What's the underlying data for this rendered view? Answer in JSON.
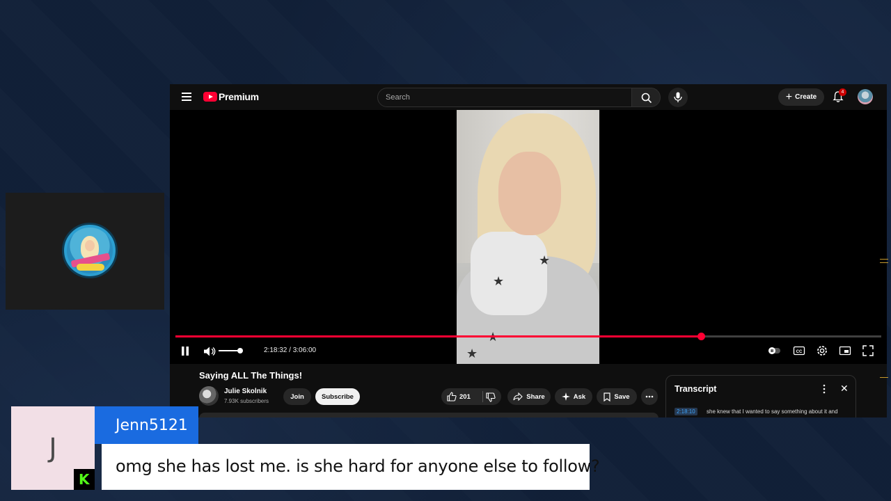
{
  "youtube": {
    "logo_text": "Premium",
    "search_placeholder": "Search",
    "create_label": "Create",
    "notification_count": "4",
    "player": {
      "time": "2:18:32 / 3:06:00",
      "progress_fraction": 0.745,
      "volume_fraction": 0.85,
      "playing": true
    },
    "video": {
      "title": "Saying ALL The Things!",
      "channel_name": "Julie Skolnik",
      "subscribers": "7.93K subscribers",
      "join_label": "Join",
      "subscribe_label": "Subscribe",
      "like_count": "201",
      "share_label": "Share",
      "ask_label": "Ask",
      "save_label": "Save"
    },
    "transcript": {
      "title": "Transcript",
      "entries": [
        {
          "time": "2:18:10",
          "text": "she knew that I wanted to say something about it and"
        }
      ]
    }
  },
  "chat": {
    "avatar_initial": "J",
    "username": "Jenn5121",
    "message": "omg she has lost me. is she hard for anyone else to follow?",
    "platform_badge": "K"
  },
  "colors": {
    "yt_red": "#ff0033",
    "chat_name_bg": "#1a6be0",
    "kick_green": "#53fc18",
    "page_bg": "#112038"
  }
}
